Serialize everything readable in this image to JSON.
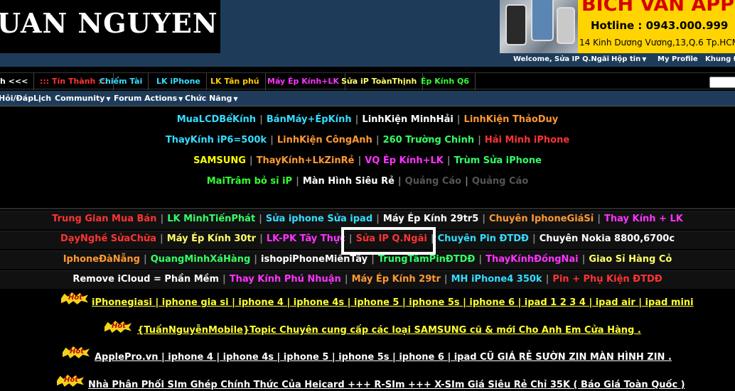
{
  "header": {
    "logo_text": "UAN NGUYEN",
    "banner": {
      "brand": "BICH VAN APPLE",
      "hotline": "Hotline : 0943.000.999",
      "address": "14 Kinh Dương Vương,13,Q.6 Tp.HCM"
    }
  },
  "userbar": {
    "welcome": "Welcome,",
    "username": "Sửa IP Q.Ngãi",
    "inbox": "Hộp tin",
    "profile": "My Profile",
    "extra": "Khung Đ"
  },
  "top_tabs": [
    {
      "label": "h <<<",
      "color": "#ffffff"
    },
    {
      "label": "::: Tín Thành :::",
      "color": "#ff3333"
    },
    {
      "label": "Chiểm Tài",
      "color": "#33ddff"
    },
    {
      "label": "LK iPhone",
      "color": "#33ddff"
    },
    {
      "label": "LK Tân phú",
      "color": "#ffcc00"
    },
    {
      "label": "Máy Ép Kính+LK",
      "color": "#ff33ff"
    },
    {
      "label": "Sửa iP ToànThịnh",
      "color": "#ffff66"
    },
    {
      "label": "Ép Kính Q6",
      "color": "#33ff33"
    }
  ],
  "forum_nav": [
    {
      "label": "Hỏi/Đáp",
      "dropdown": false
    },
    {
      "label": "Lịch",
      "dropdown": false
    },
    {
      "label": "Community",
      "dropdown": true
    },
    {
      "label": "Forum Actions",
      "dropdown": true
    },
    {
      "label": "Chức Năng",
      "dropdown": true
    }
  ],
  "block1": [
    [
      {
        "text": "MuaLCDBểKính",
        "color": "#33ddff"
      },
      {
        "text": "BánMáy+ÉpKính",
        "color": "#33ddff"
      },
      {
        "text": "LinhKiện MinhHải",
        "color": "#ffffff"
      },
      {
        "text": "LinhKiện ThảoDuy",
        "color": "#ff9933"
      }
    ],
    [
      {
        "text": "ThayKính iP6=500k",
        "color": "#33ddff"
      },
      {
        "text": "LinhKiện CôngAnh",
        "color": "#ff9933"
      },
      {
        "text": "260 Trường Chinh",
        "color": "#33ff66"
      },
      {
        "text": "Hải Minh iPhone",
        "color": "#ff3333"
      }
    ],
    [
      {
        "text": "SAMSUNG",
        "color": "#ffff00"
      },
      {
        "text": "ThayKính+LkZinRẻ",
        "color": "#ff9933"
      },
      {
        "text": "VQ Ép Kính+LK",
        "color": "#ff33ff"
      },
      {
        "text": "Trùm Sửa iPhone",
        "color": "#33ff66"
      }
    ],
    [
      {
        "text": "MaiTrâm bỏ sỉ iP",
        "color": "#33ff33"
      },
      {
        "text": "Màn Hình Siêu Rẻ",
        "color": "#ffffff"
      },
      {
        "text": "Quảng Cáo",
        "color": "#555555"
      },
      {
        "text": "Quảng Cáo",
        "color": "#555555"
      }
    ]
  ],
  "block2": [
    [
      {
        "text": "Trung Gian Mua Bán",
        "color": "#ff3333"
      },
      {
        "text": "LK MinhTiếnPhát",
        "color": "#33ff66"
      },
      {
        "text": "Sửa iphone Sửa ipad",
        "color": "#33ddff"
      },
      {
        "text": "Máy Ép Kính 29tr5",
        "color": "#ffffff"
      },
      {
        "text": "Chuyên IphoneGiáSỉ",
        "color": "#ff9933"
      },
      {
        "text": "Thay Kính + LK",
        "color": "#ff33ff"
      }
    ],
    [
      {
        "text": "DạyNghề SửaChữa",
        "color": "#ff3333"
      },
      {
        "text": "Máy Ép Kính 30tr",
        "color": "#ffff66"
      },
      {
        "text": "LK-PK Tây Thực",
        "color": "#ff33ff"
      },
      {
        "text": "Sửa IP Q.Ngãi",
        "color": "#ff3333"
      },
      {
        "text": "Chuyên Pin ĐTDĐ",
        "color": "#33ddff"
      },
      {
        "text": "Chuyên Nokia 8800,6700c",
        "color": "#ffffff"
      }
    ],
    [
      {
        "text": "IphoneĐàNẵng",
        "color": "#ff9933"
      },
      {
        "text": "QuangMinhXáHàng",
        "color": "#33ff66"
      },
      {
        "text": "ishopiPhoneMiềnTây",
        "color": "#ffffff"
      },
      {
        "text": "TrungTâmPinĐTDĐ",
        "color": "#33ff66"
      },
      {
        "text": "ThayKínhĐồngNai",
        "color": "#ff33ff"
      },
      {
        "text": "Giao Sỉ Hàng Cỏ",
        "color": "#ffff66"
      }
    ],
    [
      {
        "text": "Remove iCloud = Phần Mềm",
        "color": "#ffffff"
      },
      {
        "text": "Thay Kính Phú Nhuận",
        "color": "#ff33ff"
      },
      {
        "text": "Máy Ép Kính 29tr",
        "color": "#ff9933"
      },
      {
        "text": "MH iPhone4 350k",
        "color": "#33ddff"
      },
      {
        "text": "Pin + Phụ Kiện ĐTDĐ",
        "color": "#ff3333"
      }
    ]
  ],
  "hot_badge_text": "Hot",
  "hot_topics": [
    {
      "text": "iPhonegiasi | iphone gia si | iphone 4 | iphone 4s | iphone 5 | iphone 5s | iphone 6 | ipad 1 2 3 4 | ipad air | ipad mini",
      "color": "#ffff33"
    },
    {
      "text": "{TuấnNguyễnMobile}Topic Chuyên cung cấp các loại SAMSUNG cũ & mới Cho Anh Em Cửa Hàng .",
      "color": "#ffff33"
    },
    {
      "text": "ApplePro.vn | iphone 4 | iphone 4s | iphone 5 | iphone 5s | iphone 6 | ipad CŨ GIÁ RẺ SƯỜN ZIN MÀN HÌNH ZIN .",
      "color": "#ffffff"
    },
    {
      "text": "Nhà Phân Phối SIm Ghép Chính Thức Của Heicard +++ R-SIm +++ X-SIm Giá Siêu Rẻ Chỉ 35K ( Báo Giá Toàn Quốc )",
      "color": "#ffffff"
    }
  ]
}
